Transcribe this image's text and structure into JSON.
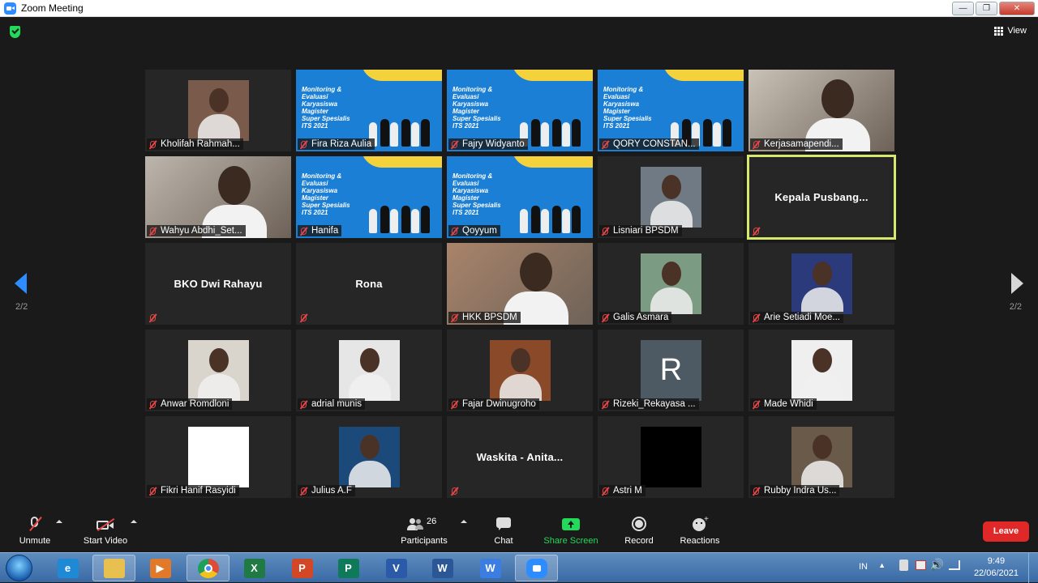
{
  "window": {
    "title": "Zoom Meeting"
  },
  "view": {
    "label": "View"
  },
  "pagination": {
    "left": "2/2",
    "right": "2/2"
  },
  "banner_text": [
    "Monitoring &",
    "Evaluasi",
    "Karyasiswa",
    "Magister",
    "Super Spesialis",
    "ITS 2021"
  ],
  "participants": [
    {
      "name": "Kholifah Rahmah...",
      "kind": "photo",
      "color": "#7a5a4a"
    },
    {
      "name": "Fira Riza Aulia",
      "kind": "banner"
    },
    {
      "name": "Fajry Widyanto",
      "kind": "banner"
    },
    {
      "name": "QORY CONSTAN...",
      "kind": "banner"
    },
    {
      "name": "Kerjasamapendi...",
      "kind": "full",
      "color": "#c9c2b6"
    },
    {
      "name": "Wahyu Abdhi_Set...",
      "kind": "full",
      "color": "#bdb6ad"
    },
    {
      "name": "Hanifa",
      "kind": "banner"
    },
    {
      "name": "Qoyyum",
      "kind": "banner"
    },
    {
      "name": "Lisniari BPSDM",
      "kind": "photo",
      "color": "#6f7a85"
    },
    {
      "name": "Kepala  Pusbang...",
      "kind": "text",
      "active": true
    },
    {
      "name": "BKO Dwi Rahayu",
      "kind": "text"
    },
    {
      "name": "Rona",
      "kind": "text"
    },
    {
      "name": "HKK BPSDM",
      "kind": "full",
      "color": "#a9846a"
    },
    {
      "name": "Galis Asmara",
      "kind": "photo",
      "color": "#7b9c82"
    },
    {
      "name": "Arie Setiadi Moe...",
      "kind": "photo",
      "color": "#2b3a7a"
    },
    {
      "name": "Anwar Romdloni",
      "kind": "photo",
      "color": "#d9d4cc"
    },
    {
      "name": "adrial munis",
      "kind": "photo",
      "color": "#e6e6e6"
    },
    {
      "name": "Fajar Dwinugroho",
      "kind": "photo",
      "color": "#8a4a2a"
    },
    {
      "name": "Rizeki_Rekayasa ...",
      "kind": "initial",
      "initial": "R",
      "color": "#4e5a63"
    },
    {
      "name": "Made Whidi",
      "kind": "photo",
      "color": "#efefef"
    },
    {
      "name": "Fikri Hanif Rasyidi",
      "kind": "photo",
      "color": "#ffffff"
    },
    {
      "name": "Julius A.F",
      "kind": "photo",
      "color": "#1b4a7a"
    },
    {
      "name": "Waskita  - Anita...",
      "kind": "text"
    },
    {
      "name": "Astri M",
      "kind": "photo",
      "color": "#000000"
    },
    {
      "name": "Rubby Indra Us...",
      "kind": "photo",
      "color": "#6a5a4a"
    }
  ],
  "toolbar": {
    "unmute": "Unmute",
    "start_video": "Start Video",
    "participants": "Participants",
    "participants_count": "26",
    "chat": "Chat",
    "share_screen": "Share Screen",
    "record": "Record",
    "reactions": "Reactions",
    "leave": "Leave"
  },
  "taskbar": {
    "language": "IN",
    "time": "9:49",
    "date": "22/06/2021",
    "apps": [
      {
        "name": "internet-explorer",
        "letter": "e",
        "color": "#1e8ad6"
      },
      {
        "name": "file-explorer",
        "letter": "",
        "color": "#e8c050"
      },
      {
        "name": "media-player",
        "letter": "▶",
        "color": "#e07a2a"
      },
      {
        "name": "chrome",
        "letter": "",
        "color": "#dd4b39"
      },
      {
        "name": "excel",
        "letter": "X",
        "color": "#1f7a44"
      },
      {
        "name": "powerpoint",
        "letter": "P",
        "color": "#d24726"
      },
      {
        "name": "publisher",
        "letter": "P",
        "color": "#0e7a5a"
      },
      {
        "name": "visio",
        "letter": "V",
        "color": "#2a5aa8"
      },
      {
        "name": "word",
        "letter": "W",
        "color": "#2b5797"
      },
      {
        "name": "wps",
        "letter": "W",
        "color": "#3b7de0"
      },
      {
        "name": "zoom",
        "letter": "",
        "color": "#2d8cff"
      }
    ]
  }
}
